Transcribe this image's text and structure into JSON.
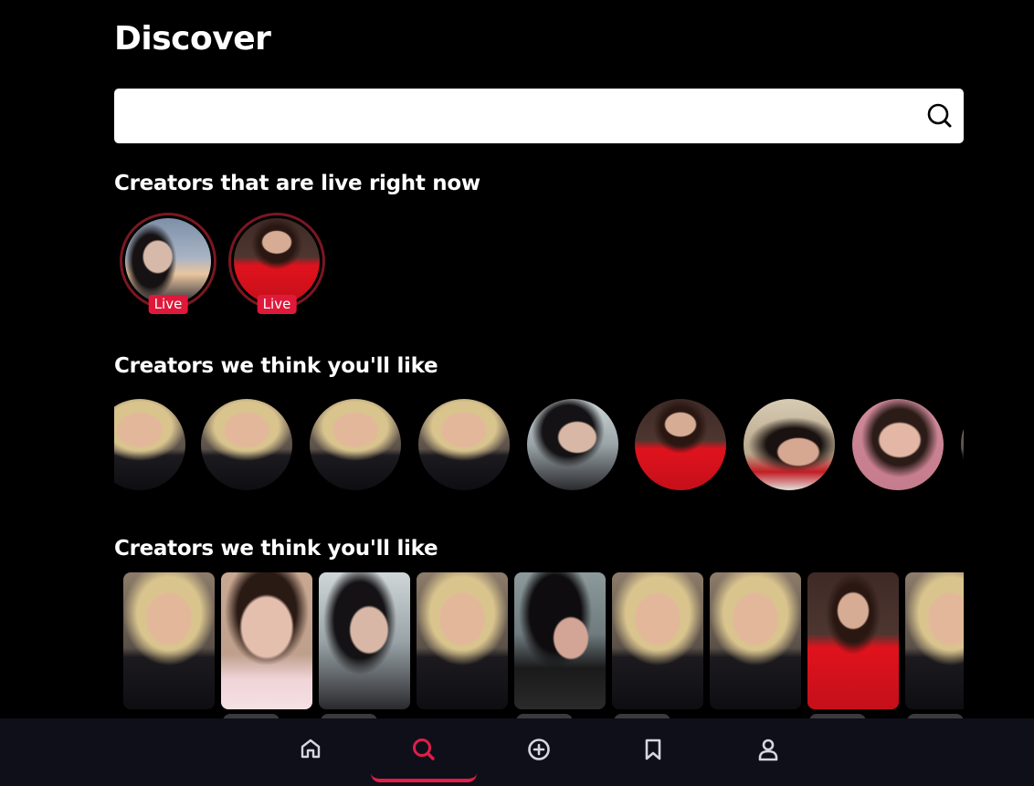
{
  "page": {
    "title": "Discover"
  },
  "search": {
    "value": "",
    "placeholder": "",
    "icon": "search-icon"
  },
  "live_section": {
    "title": "Creators that are live right now",
    "creators": [
      {
        "photo": "sky-selfie",
        "badge": "Live"
      },
      {
        "photo": "red-dress",
        "badge": "Live"
      }
    ]
  },
  "recommended_section": {
    "title": "Creators we think you'll like",
    "creators": [
      {
        "photo": "doll"
      },
      {
        "photo": "doll"
      },
      {
        "photo": "doll"
      },
      {
        "photo": "doll"
      },
      {
        "photo": "dark-hair"
      },
      {
        "photo": "red-dress"
      },
      {
        "photo": "lying"
      },
      {
        "photo": "pink-background"
      },
      {
        "photo": "doll"
      }
    ]
  },
  "featured_section": {
    "title": "Creators we think you'll like",
    "creators": [
      {
        "photo": "doll"
      },
      {
        "photo": "selfie"
      },
      {
        "photo": "dark-hair"
      },
      {
        "photo": "doll"
      },
      {
        "photo": "floral"
      },
      {
        "photo": "doll"
      },
      {
        "photo": "doll"
      },
      {
        "photo": "red-dress"
      },
      {
        "photo": "doll"
      }
    ]
  },
  "bottom_nav": {
    "active": "search",
    "accent_color": "#e11d48",
    "items": [
      {
        "name": "home",
        "icon": "home-icon"
      },
      {
        "name": "search",
        "icon": "search-icon"
      },
      {
        "name": "create",
        "icon": "plus-circle-icon"
      },
      {
        "name": "saved",
        "icon": "bookmark-icon"
      },
      {
        "name": "profile",
        "icon": "user-icon"
      }
    ]
  },
  "colors": {
    "background": "#000000",
    "nav_background": "#0f0f1a",
    "live_badge": "#e0193a",
    "live_ring": "#7a1721"
  }
}
